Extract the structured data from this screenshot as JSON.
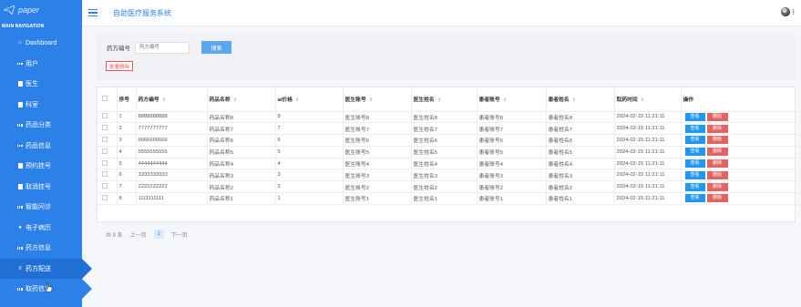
{
  "sidebar": {
    "logo_text": "paper",
    "nav_header": "MAIN NAVIGATION",
    "items": [
      {
        "label": "Dashboard",
        "icon": "home-icon"
      },
      {
        "label": "用户",
        "icon": "grid-icon"
      },
      {
        "label": "医生",
        "icon": "doc-icon"
      },
      {
        "label": "科室",
        "icon": "doc-icon"
      },
      {
        "label": "药品分类",
        "icon": "grid-icon"
      },
      {
        "label": "药品信息",
        "icon": "grid-icon"
      },
      {
        "label": "预约挂号",
        "icon": "doc-icon"
      },
      {
        "label": "取消挂号",
        "icon": "doc-icon"
      },
      {
        "label": "智能问诊",
        "icon": "grid-icon"
      },
      {
        "label": "电子病历",
        "icon": "user-icon"
      },
      {
        "label": "药方信息",
        "icon": "grid-icon"
      },
      {
        "label": "药方配送",
        "icon": "list-icon"
      },
      {
        "label": "取药信息",
        "icon": "grid-icon"
      }
    ]
  },
  "header": {
    "title": "自助医疗服务系统"
  },
  "search": {
    "label": "药方编号",
    "placeholder": "药方编号",
    "button": "搜索"
  },
  "batch_delete": "批量删除",
  "table": {
    "columns": [
      "序号",
      "药方编号",
      "药品名称",
      "ai价格",
      "医生账号",
      "医生姓名",
      "患者账号",
      "患者姓名",
      "取药时间",
      "操作"
    ],
    "rows": [
      [
        "1",
        "8888888888",
        "药品名称8",
        "8",
        "医生账号8",
        "医生姓名8",
        "患者账号8",
        "患者姓名8",
        "2024-02-15 11:21:11"
      ],
      [
        "2",
        "7777777777",
        "药品名称7",
        "7",
        "医生账号7",
        "医生姓名7",
        "患者账号7",
        "患者姓名7",
        "2024-02-15 11:21:11"
      ],
      [
        "3",
        "6666666666",
        "药品名称6",
        "6",
        "医生账号6",
        "医生姓名6",
        "患者账号6",
        "患者姓名6",
        "2024-02-15 11:21:11"
      ],
      [
        "4",
        "5555555555",
        "药品名称5",
        "5",
        "医生账号5",
        "医生姓名5",
        "患者账号5",
        "患者姓名5",
        "2024-02-15 11:21:11"
      ],
      [
        "5",
        "4444444444",
        "药品名称4",
        "4",
        "医生账号4",
        "医生姓名4",
        "患者账号4",
        "患者姓名4",
        "2024-02-15 11:21:11"
      ],
      [
        "6",
        "3333333333",
        "药品名称3",
        "3",
        "医生账号3",
        "医生姓名3",
        "患者账号3",
        "患者姓名3",
        "2024-02-15 11:21:11"
      ],
      [
        "7",
        "2222222222",
        "药品名称2",
        "2",
        "医生账号2",
        "医生姓名2",
        "患者账号2",
        "患者姓名2",
        "2024-02-15 11:21:11"
      ],
      [
        "8",
        "1111111111",
        "药品名称1",
        "1",
        "医生账号1",
        "医生姓名1",
        "患者账号1",
        "患者姓名1",
        "2024-02-15 11:21:11"
      ]
    ],
    "view_label": "查看",
    "delete_label": "删除"
  },
  "pager": {
    "total": "共 8 条",
    "prev": "上一页",
    "current": "1",
    "next": "下一页"
  },
  "colors": {
    "sidebar": "#2b81e8",
    "accent": "#2b81e8",
    "danger": "#e36262",
    "view": "#2196f3"
  }
}
